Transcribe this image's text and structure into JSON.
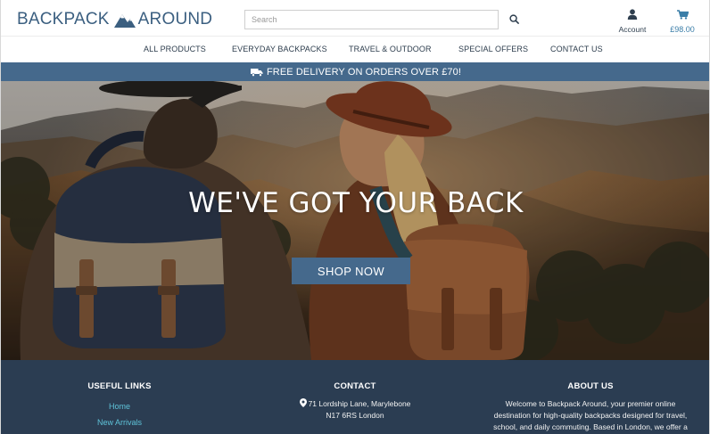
{
  "brand": {
    "left": "BACKPACK",
    "right": "AROUND"
  },
  "search": {
    "placeholder": "Search"
  },
  "icons": {
    "search": "search-icon",
    "account": "user-icon",
    "cart": "shopping-cart-icon",
    "truck": "truck-icon",
    "location": "map-marker-icon"
  },
  "header": {
    "account_label": "Account",
    "cart_total": "£98.00"
  },
  "nav": {
    "items": [
      {
        "label": "ALL PRODUCTS"
      },
      {
        "label": "EVERYDAY BACKPACKS"
      },
      {
        "label": "TRAVEL & OUTDOOR"
      },
      {
        "label": "SPECIAL OFFERS"
      },
      {
        "label": "CONTACT US"
      }
    ]
  },
  "banner": {
    "text": "FREE DELIVERY ON ORDERS OVER £70!"
  },
  "hero": {
    "title": "WE'VE GOT YOUR BACK",
    "cta": "SHOP NOW"
  },
  "footer": {
    "useful_links": {
      "title": "USEFUL LINKS",
      "links": [
        "Home",
        "New Arrivals"
      ]
    },
    "contact": {
      "title": "CONTACT",
      "line1": "71 Lordship Lane, Marylebone",
      "line2": "N17 6RS London"
    },
    "about": {
      "title": "ABOUT US",
      "line1": "Welcome to Backpack Around, your premier online",
      "line2": "destination for high-quality backpacks designed for travel,",
      "line3": "school, and daily commuting. Based in London, we offer a"
    }
  },
  "colors": {
    "brand": "#3b5f80",
    "banner": "#45698c",
    "footer": "#2b3d52",
    "link": "#5fc3d9",
    "cart": "#3b7ea8"
  }
}
